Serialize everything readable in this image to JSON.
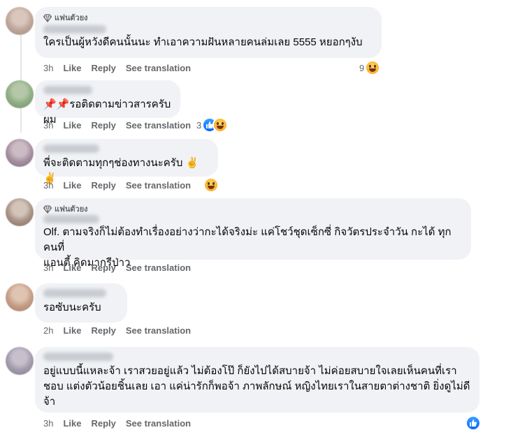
{
  "comments": [
    {
      "fan_badge": "แฟนตัวยง",
      "text": "ใครเป็นผู้หวังดีคนนั้นนะ ทำเอาความฝันหลายคนล่มเลย 5555 หยอกๆงับ",
      "time": "3h",
      "like": "Like",
      "reply": "Reply",
      "translate": "See translation",
      "reaction_count": "9"
    },
    {
      "text": "📌📌รอติดตามข่าวสารครับผม",
      "time": "3h",
      "like": "Like",
      "reply": "Reply",
      "translate": "See translation",
      "reaction_count": "3"
    },
    {
      "text": "พี่จะติดตามทุกๆช่องทางนะครับ ✌️✌️",
      "time": "3h",
      "like": "Like",
      "reply": "Reply",
      "translate": "See translation"
    },
    {
      "fan_badge": "แฟนตัวยง",
      "text": "Olf. ตามจริงก็ไม่ต้องทำเรื่องอย่างว่ากะได้จริงม่ะ แค่โชว์ชุดเซ็กซี่ กิจวัตรประจำวัน กะได้ ทุกคนที่\nแอนตี้ คิดมากรีป่าว",
      "time": "3h",
      "like": "Like",
      "reply": "Reply",
      "translate": "See translation"
    },
    {
      "text": "รอซับนะครับ",
      "time": "2h",
      "like": "Like",
      "reply": "Reply",
      "translate": "See translation"
    },
    {
      "text": "อยู่แบบนี้แหละจ้า เราสวยอยู่แล้ว ไม่ต้องโป๊ ก็ยังไปได้สบายจ้า ไม่ค่อยสบายใจเลยเห็นคนที่เรา\nชอบ แต่งตัวน้อยชิ้นเลย เอา แค่น่ารักก็พอจ้า ภาพลักษณ์ หญิงไทยเราในสายตาต่างชาติ ยิ่งดูไม่ดี\nจ้า",
      "time": "3h",
      "like": "Like",
      "reply": "Reply",
      "translate": "See translation"
    }
  ]
}
